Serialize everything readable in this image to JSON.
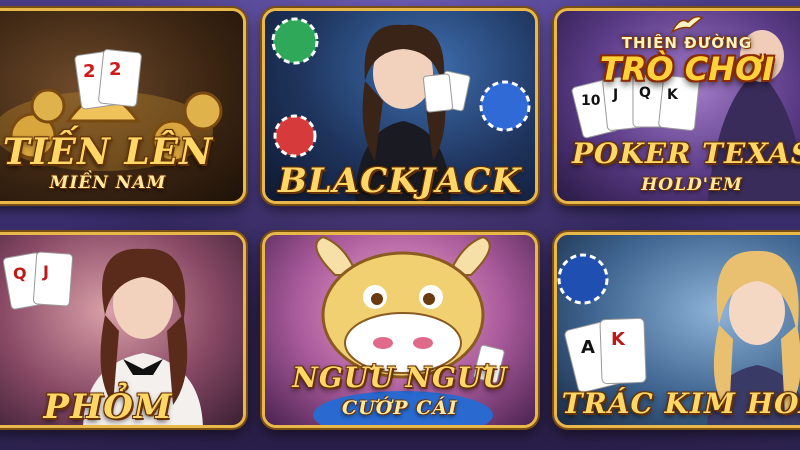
{
  "logo": {
    "top": "THIÊN ĐƯỜNG",
    "main": "TRÒ CHƠI"
  },
  "games": [
    {
      "title": "TIẾN LÊN",
      "subtitle": "MIỀN NAM"
    },
    {
      "title": "BLACKJACK",
      "subtitle": ""
    },
    {
      "title": "POKER TEXAS",
      "subtitle": "HOLD'EM"
    },
    {
      "title": "PHỎM",
      "subtitle": ""
    },
    {
      "title": "NGƯU NGƯU",
      "subtitle": "CƯỚP CÁI"
    },
    {
      "title": "TRÁC KIM HOA",
      "subtitle": ""
    }
  ],
  "colors": {
    "frame_gold": "#e9b84a",
    "title_gold": "#ffd766",
    "background": "#3b2f70"
  }
}
